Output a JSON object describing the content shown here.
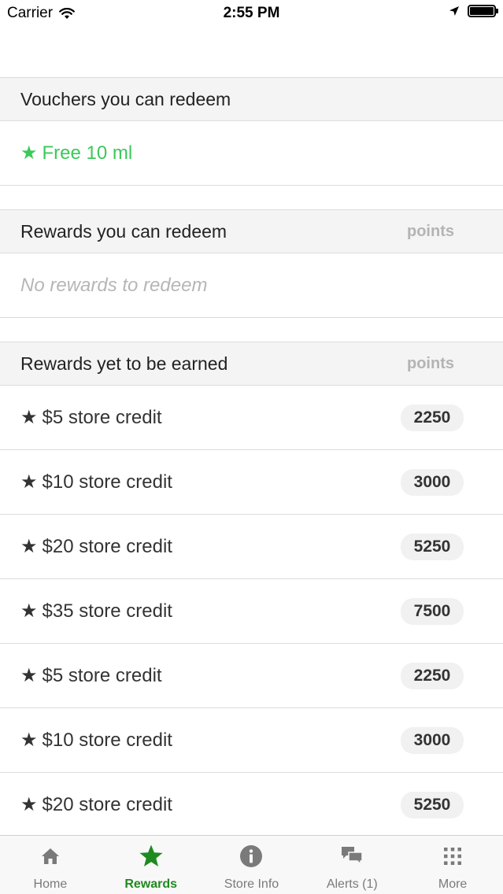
{
  "status_bar": {
    "carrier": "Carrier",
    "time": "2:55 PM"
  },
  "sections": {
    "vouchers": {
      "title": "Vouchers you can redeem",
      "items": [
        {
          "label": "Free 10 ml"
        }
      ]
    },
    "redeemable": {
      "title": "Rewards you can redeem",
      "points_label": "points",
      "empty_text": "No rewards to redeem"
    },
    "to_earn": {
      "title": "Rewards yet to be earned",
      "points_label": "points",
      "items": [
        {
          "label": "$5 store credit",
          "points": "2250"
        },
        {
          "label": "$10 store credit",
          "points": "3000"
        },
        {
          "label": "$20 store credit",
          "points": "5250"
        },
        {
          "label": "$35 store credit",
          "points": "7500"
        },
        {
          "label": "$5 store credit",
          "points": "2250"
        },
        {
          "label": "$10 store credit",
          "points": "3000"
        },
        {
          "label": "$20 store credit",
          "points": "5250"
        }
      ]
    }
  },
  "tab_bar": {
    "tabs": [
      {
        "label": "Home",
        "icon": "home-icon"
      },
      {
        "label": "Rewards",
        "icon": "star-icon"
      },
      {
        "label": "Store Info",
        "icon": "info-icon"
      },
      {
        "label": "Alerts (1)",
        "icon": "chat-bubbles-icon"
      },
      {
        "label": "More",
        "icon": "grid-dots-icon"
      }
    ],
    "active_index": 1
  },
  "colors": {
    "accent_green": "#1f8a1f",
    "voucher_green": "#3ac95a",
    "tab_inactive": "#7a7a7a"
  },
  "icons": {
    "star_glyph": "★"
  }
}
